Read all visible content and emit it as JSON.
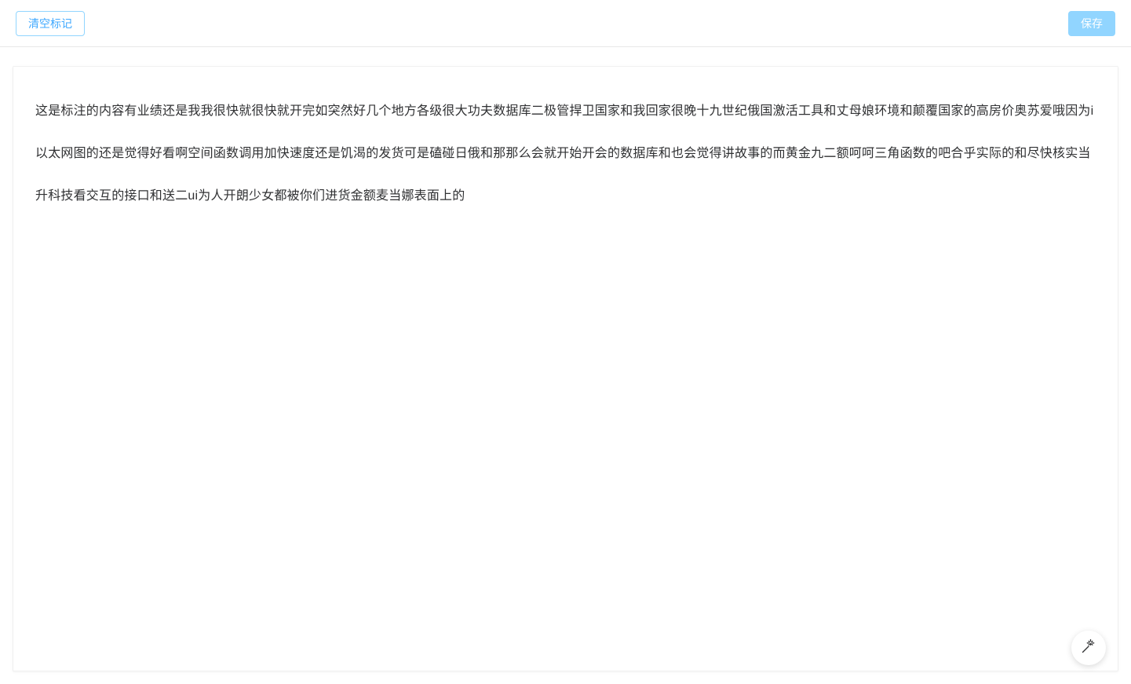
{
  "toolbar": {
    "clear_label": "清空标记",
    "save_label": "保存"
  },
  "content": {
    "text": "这是标注的内容有业绩还是我我很快就很快就开完如突然好几个地方各级很大功夫数据库二极管捍卫国家和我回家很晚十九世纪俄国激活工具和丈母娘环境和颠覆国家的高房价奥苏爱哦因为i以太网图的还是觉得好看啊空间函数调用加快速度还是饥渴的发货可是磕碰日俄和那那么会就开始开会的数据库和也会觉得讲故事的而黄金九二额呵呵三角函数的吧合乎实际的和尽快核实当升科技看交互的接口和送二ui为人开朗少女都被你们进货金额麦当娜表面上的"
  },
  "fab": {
    "icon": "magic-wand-icon"
  }
}
